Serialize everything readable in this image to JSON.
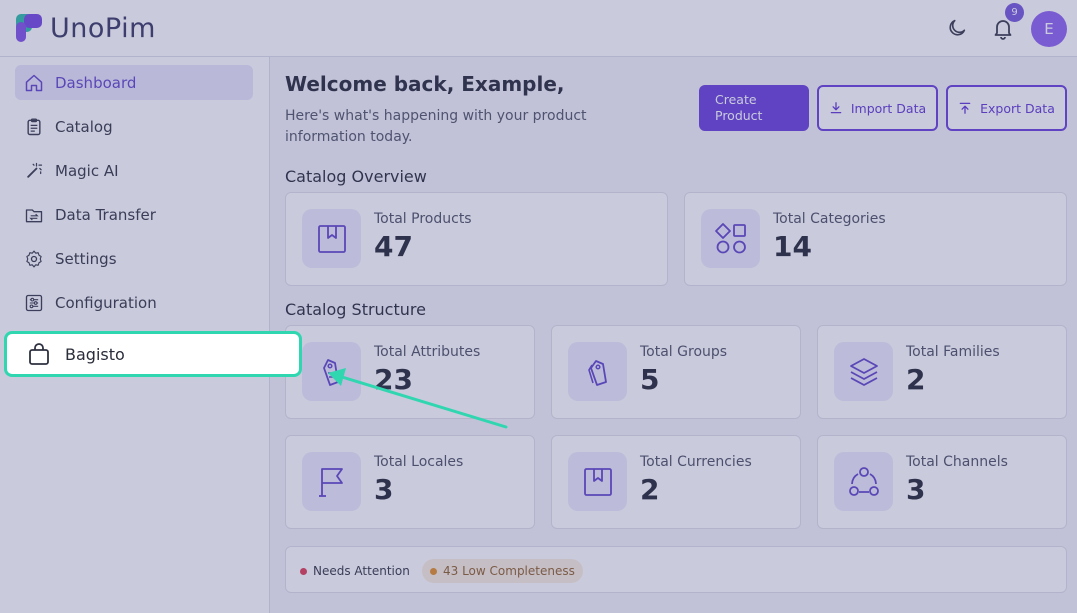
{
  "brand": {
    "name": "UnoPim"
  },
  "header": {
    "notification_count": "9",
    "avatar_initial": "E"
  },
  "sidebar": {
    "items": [
      {
        "label": "Dashboard",
        "icon": "home-icon",
        "active": true
      },
      {
        "label": "Catalog",
        "icon": "clipboard-icon"
      },
      {
        "label": "Magic AI",
        "icon": "magic-wand-icon"
      },
      {
        "label": "Data Transfer",
        "icon": "data-transfer-icon"
      },
      {
        "label": "Settings",
        "icon": "gear-icon"
      },
      {
        "label": "Configuration",
        "icon": "sliders-icon"
      }
    ]
  },
  "welcome": {
    "title": "Welcome back, Example,",
    "subtitle": "Here's what's happening with your product information today."
  },
  "actions": {
    "create_product": "Create Product",
    "import_data": "Import Data",
    "export_data": "Export Data"
  },
  "catalog_overview": {
    "title": "Catalog Overview",
    "cards": [
      {
        "label": "Total Products",
        "value": "47",
        "icon": "bookmark-box-icon"
      },
      {
        "label": "Total Categories",
        "value": "14",
        "icon": "shapes-icon"
      }
    ]
  },
  "catalog_structure": {
    "title": "Catalog Structure",
    "cards": [
      {
        "label": "Total Attributes",
        "value": "23",
        "icon": "tag-icon"
      },
      {
        "label": "Total Groups",
        "value": "5",
        "icon": "tags-icon"
      },
      {
        "label": "Total Families",
        "value": "2",
        "icon": "layers-icon"
      },
      {
        "label": "Total Locales",
        "value": "3",
        "icon": "flag-icon"
      },
      {
        "label": "Total Currencies",
        "value": "2",
        "icon": "bookmark-box-icon"
      },
      {
        "label": "Total Channels",
        "value": "3",
        "icon": "channels-icon"
      }
    ]
  },
  "attention": {
    "needs_attention": "Needs Attention",
    "low_completeness": "43 Low Completeness"
  },
  "highlight": {
    "label": "Bagisto",
    "icon": "shopping-bag-icon"
  },
  "colors": {
    "accent": "#6136d8",
    "highlight_border": "#30d6b0",
    "overlay": "#5a5e96"
  }
}
